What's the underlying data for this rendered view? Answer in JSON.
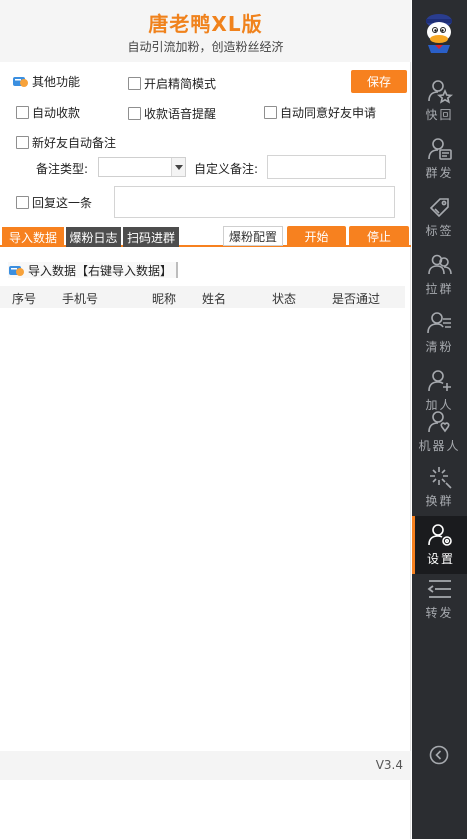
{
  "header": {
    "title": "唐老鸭XL版",
    "subtitle": "自动引流加粉，创造粉丝经济"
  },
  "options": {
    "other_features": "其他功能",
    "simple_mode": "开启精简模式",
    "save_button": "保存",
    "auto_receive": "自动收款",
    "voice_reminder": "收款语音提醒",
    "auto_accept_friend": "自动同意好友申请",
    "auto_remark": "新好友自动备注",
    "remark_type_label": "备注类型:",
    "remark_type_value": "",
    "custom_remark_label": "自定义备注:",
    "custom_remark_value": "",
    "reply_once": "回复这一条",
    "reply_text": ""
  },
  "tabs": {
    "import": "导入数据",
    "log": "爆粉日志",
    "scan": "扫码进群",
    "config": "爆粉配置",
    "start": "开始",
    "stop": "停止"
  },
  "section": {
    "title": "导入数据【右键导入数据】"
  },
  "table": {
    "columns": [
      "序号",
      "手机号",
      "昵称",
      "姓名",
      "状态",
      "是否通过"
    ],
    "rows": []
  },
  "footer": {
    "version": "V3.4"
  },
  "sidebar": {
    "items": [
      {
        "label": "快回",
        "icon": "star-user-icon"
      },
      {
        "label": "群发",
        "icon": "send-card-icon"
      },
      {
        "label": "标签",
        "icon": "tag-icon"
      },
      {
        "label": "拉群",
        "icon": "group-icon"
      },
      {
        "label": "清粉",
        "icon": "clean-fans-icon"
      },
      {
        "label": "加人",
        "icon": "add-user-icon"
      },
      {
        "label": "机器人",
        "icon": "robot-user-icon"
      },
      {
        "label": "换群",
        "icon": "sparkle-icon"
      },
      {
        "label": "设置",
        "icon": "user-settings-icon",
        "active": true
      },
      {
        "label": "转发",
        "icon": "forward-list-icon"
      }
    ]
  },
  "colors": {
    "accent": "#f7811f",
    "sidebar_bg": "#2b2d31",
    "tab_inactive": "#4d4d4d"
  }
}
